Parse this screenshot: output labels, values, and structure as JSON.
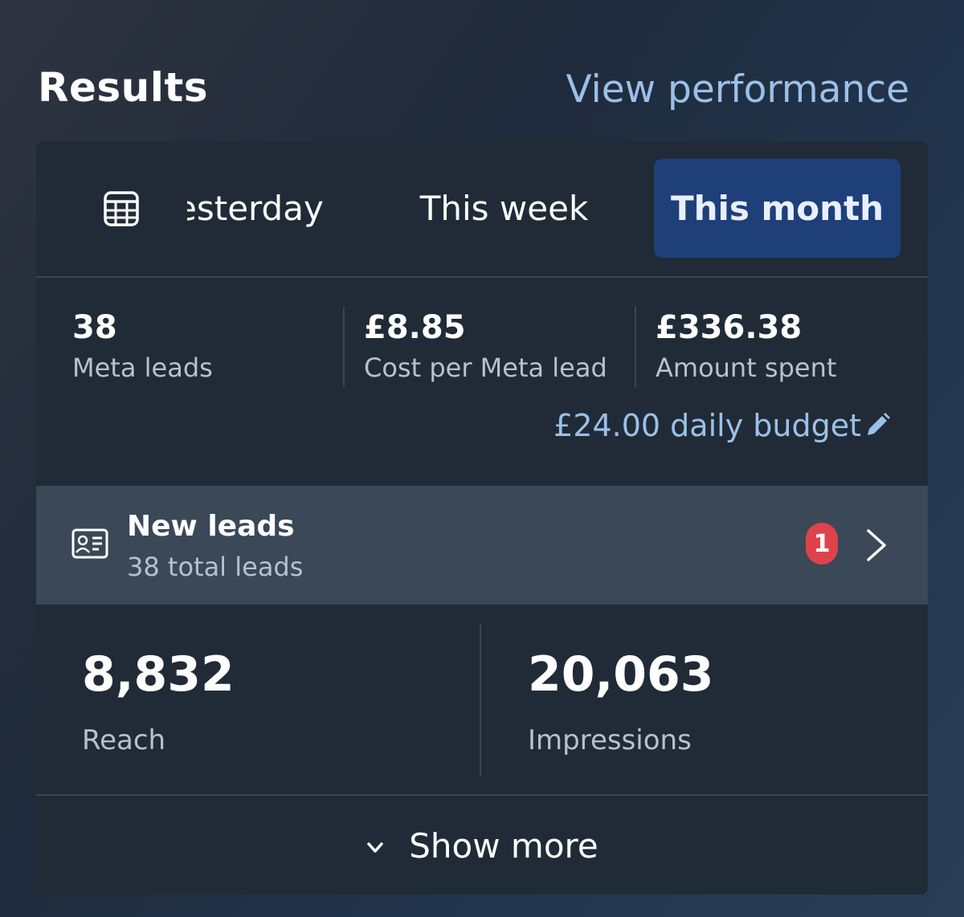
{
  "header": {
    "title": "Results",
    "link_label": "View performance"
  },
  "tabs": {
    "icon": "table-icon",
    "items": [
      "esterday",
      "This week",
      "This month"
    ],
    "selected": "This month"
  },
  "metrics": [
    {
      "value": "38",
      "label": "Meta leads"
    },
    {
      "value": "£8.85",
      "label": "Cost per Meta lead"
    },
    {
      "value": "£336.38",
      "label": "Amount spent"
    }
  ],
  "budget": {
    "label": "£24.00 daily budget",
    "icon": "pencil-icon"
  },
  "leads": {
    "icon": "contact-card-icon",
    "title": "New leads",
    "subtitle": "38 total leads",
    "badge": "1",
    "arrow_icon": "chevron-right-icon"
  },
  "stats": [
    {
      "value": "8,832",
      "label": "Reach"
    },
    {
      "value": "20,063",
      "label": "Impressions"
    }
  ],
  "footer": {
    "label": "Show more",
    "icon": "chevron-down-icon"
  },
  "colors": {
    "accent_link": "#9cc0e8",
    "selected_tab_bg": "#1f3f79",
    "card_bg": "#202b37",
    "leads_row_bg": "#3a4857",
    "badge_red": "#e0424b"
  }
}
